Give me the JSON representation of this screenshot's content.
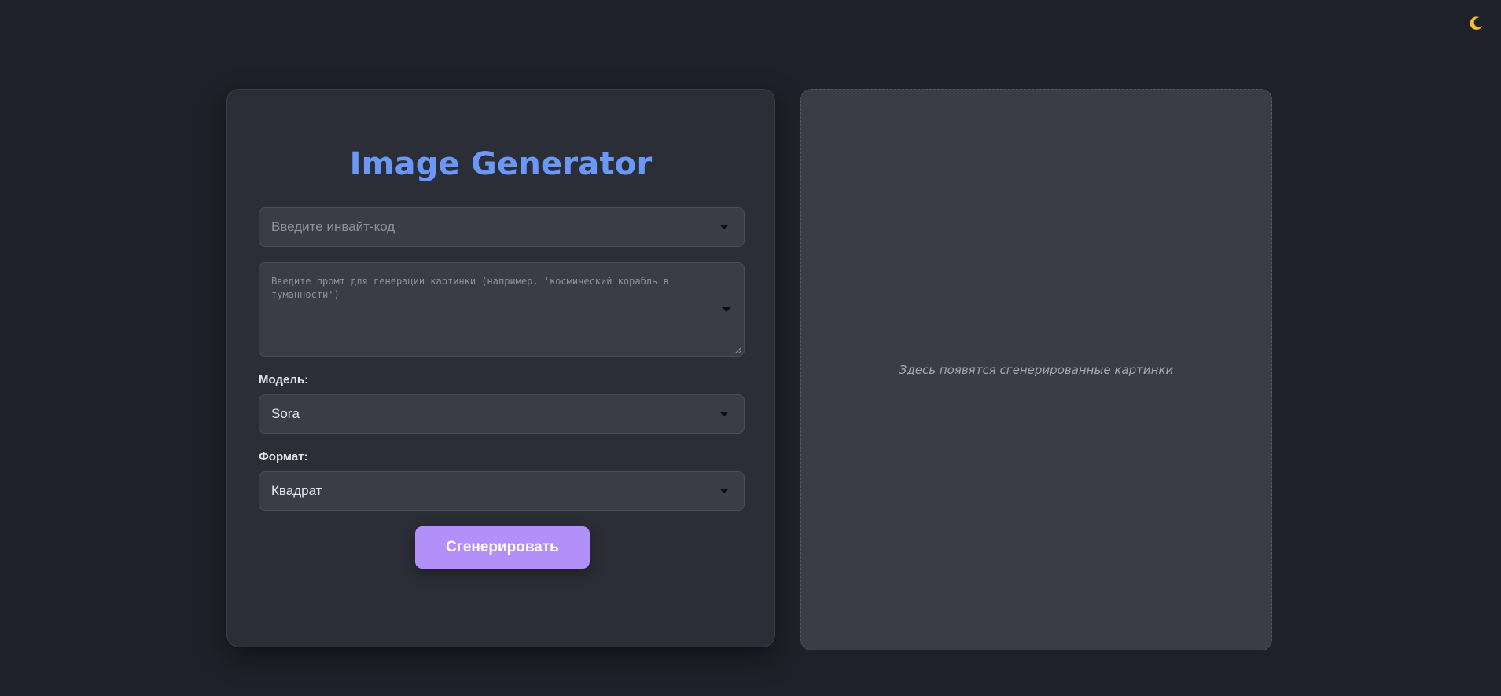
{
  "theme_toggle": {
    "icon": "moon-icon",
    "glyph": "🌙"
  },
  "form": {
    "title": "Image Generator",
    "invite_placeholder": "Введите инвайт-код",
    "prompt_placeholder": "Введите промт для генерации картинки (например, 'космический корабль в туманности')",
    "model_label": "Модель:",
    "model_value": "Sora",
    "format_label": "Формат:",
    "format_value": "Квадрат",
    "generate_label": "Сгенерировать"
  },
  "preview": {
    "empty_text": "Здесь появятся сгенерированные картинки"
  },
  "colors": {
    "background": "#1f212a",
    "card": "#2c2e37",
    "title": "#6b98f5",
    "button": "#b28ff9",
    "preview": "#3b3c47"
  }
}
